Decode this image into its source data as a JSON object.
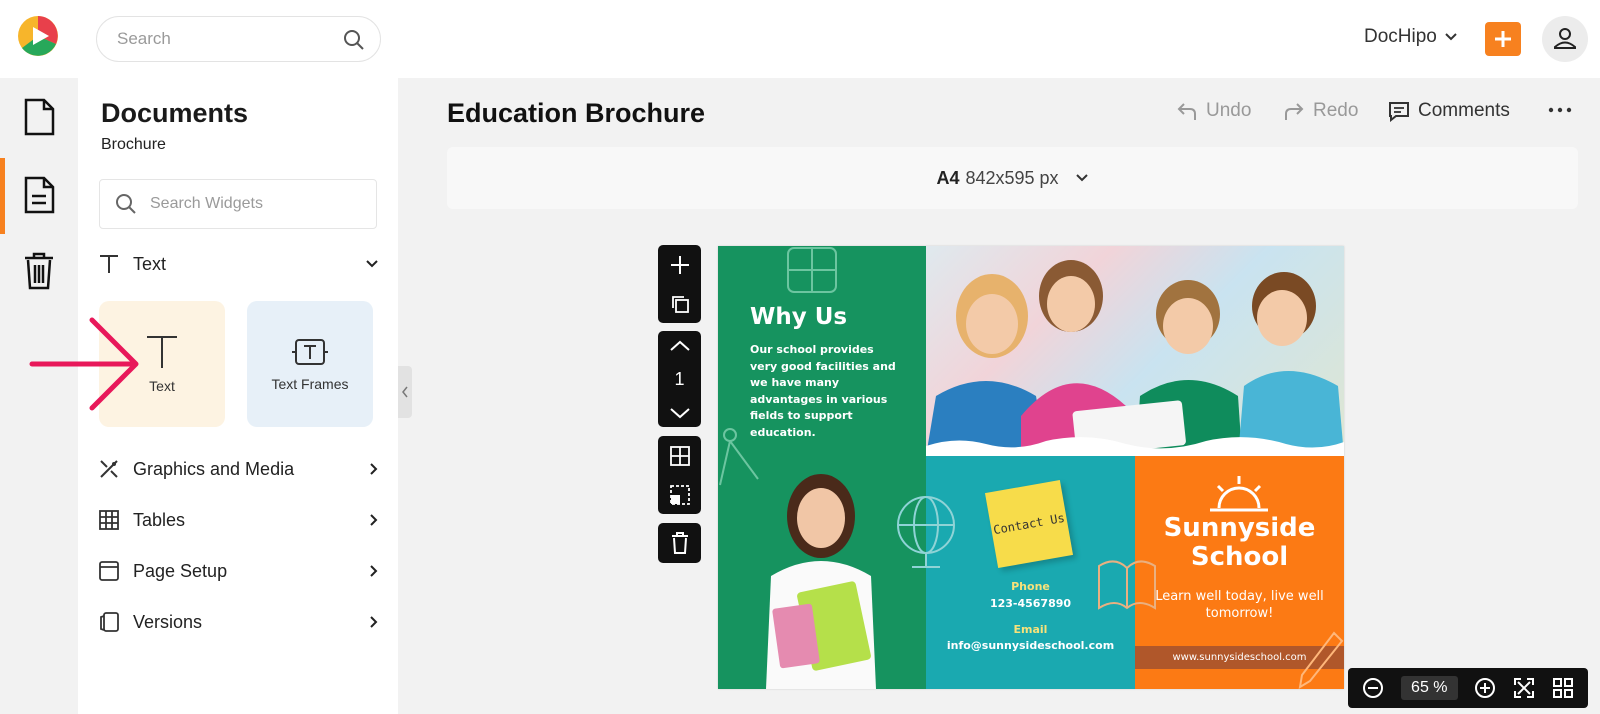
{
  "header": {
    "search_placeholder": "Search",
    "brand_menu": "DocHipo"
  },
  "panel": {
    "title": "Documents",
    "subtitle": "Brochure",
    "widget_search_placeholder": "Search Widgets",
    "text_section": "Text",
    "cards": {
      "text": "Text",
      "text_frames": "Text Frames"
    },
    "sections": [
      {
        "label": "Graphics and Media",
        "icon": "graphics-media-icon"
      },
      {
        "label": "Tables",
        "icon": "table-icon"
      },
      {
        "label": "Page Setup",
        "icon": "page-setup-icon"
      },
      {
        "label": "Versions",
        "icon": "versions-icon"
      }
    ]
  },
  "document": {
    "title": "Education Brochure",
    "undo": "Undo",
    "redo": "Redo",
    "comments": "Comments",
    "size_prefix": "A4",
    "size_value": "842x595 px",
    "page_number": "1"
  },
  "brochure": {
    "why_title": "Why Us",
    "why_body": "Our school provides very good facilities and we have many advantages in various fields to support education.",
    "note": "Contact Us",
    "phone_label": "Phone",
    "phone": "123-4567890",
    "email_label": "Email",
    "email": "info@sunnysideschool.com",
    "school_line1": "Sunnyside",
    "school_line2": "School",
    "tagline": "Learn well today, live well tomorrow!",
    "website": "www.sunnysideschool.com"
  },
  "zoom": {
    "value": "65",
    "unit": "%"
  },
  "colors": {
    "accent": "#f7811f",
    "green": "#16935f",
    "teal": "#1aa9b0",
    "orange": "#fc7a14",
    "annotation": "#e8185a"
  }
}
